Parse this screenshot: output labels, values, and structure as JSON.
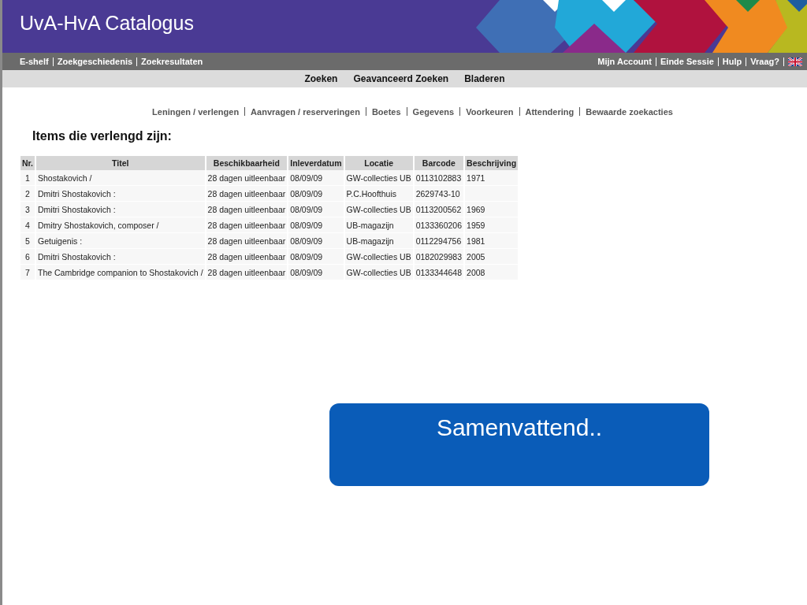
{
  "header": {
    "title": "UvA-HvA Catalogus"
  },
  "top_nav": {
    "left": [
      "E-shelf",
      "Zoekgeschiedenis",
      "Zoekresultaten"
    ],
    "right": [
      "Mijn Account",
      "Einde Sessie",
      "Hulp",
      "Vraag?"
    ]
  },
  "search_nav": [
    "Zoeken",
    "Geavanceerd Zoeken",
    "Bladeren"
  ],
  "account_nav": [
    "Leningen / verlengen",
    "Aanvragen / reserveringen",
    "Boetes",
    "Gegevens",
    "Voorkeuren",
    "Attendering",
    "Bewaarde zoekacties"
  ],
  "heading": "Items die verlengd zijn:",
  "table": {
    "columns": [
      "Nr.",
      "Titel",
      "Beschikbaarheid",
      "Inleverdatum",
      "Locatie",
      "Barcode",
      "Beschrijving"
    ],
    "rows": [
      [
        "1",
        "Shostakovich /",
        "28 dagen uitleenbaar",
        "08/09/09",
        "GW-collecties UB",
        "0113102883",
        "1971"
      ],
      [
        "2",
        "Dmitri Shostakovich :",
        "28 dagen uitleenbaar",
        "08/09/09",
        "P.C.Hoofthuis",
        "2629743-10",
        ""
      ],
      [
        "3",
        "Dmitri Shostakovich :",
        "28 dagen uitleenbaar",
        "08/09/09",
        "GW-collecties UB",
        "0113200562",
        "1969"
      ],
      [
        "4",
        "Dmitry Shostakovich, composer /",
        "28 dagen uitleenbaar",
        "08/09/09",
        "UB-magazijn",
        "0133360206",
        "1959"
      ],
      [
        "5",
        "Getuigenis :",
        "28 dagen uitleenbaar",
        "08/09/09",
        "UB-magazijn",
        "0112294756",
        "1981"
      ],
      [
        "6",
        "Dmitri Shostakovich :",
        "28 dagen uitleenbaar",
        "08/09/09",
        "GW-collecties UB",
        "0182029983",
        "2005"
      ],
      [
        "7",
        "The Cambridge companion to Shostakovich /",
        "28 dagen uitleenbaar",
        "08/09/09",
        "GW-collecties UB",
        "0133344648",
        "2008"
      ]
    ]
  },
  "callout": "Samenvattend.."
}
